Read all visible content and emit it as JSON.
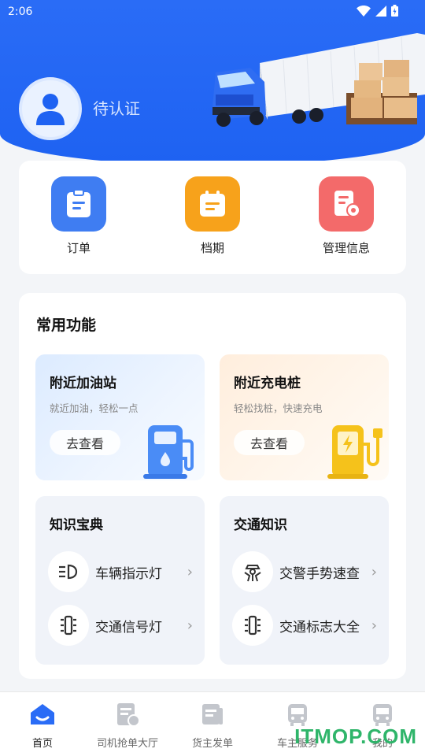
{
  "status_bar": {
    "time": "2:06"
  },
  "profile": {
    "status": "待认证"
  },
  "quick_entries": [
    {
      "label": "订单",
      "color": "#3f7df2"
    },
    {
      "label": "档期",
      "color": "#f7a21b"
    },
    {
      "label": "管理信息",
      "color": "#f36a6a"
    }
  ],
  "functions": {
    "title": "常用功能",
    "gas_station": {
      "title": "附近加油站",
      "subtitle": "就近加油，轻松一点",
      "button": "去查看"
    },
    "charging": {
      "title": "附近充电桩",
      "subtitle": "轻松找桩，快速充电",
      "button": "去查看"
    },
    "knowledge": {
      "title": "知识宝典",
      "items": [
        {
          "label": "车辆指示灯"
        },
        {
          "label": "交通信号灯"
        }
      ]
    },
    "traffic": {
      "title": "交通知识",
      "items": [
        {
          "label": "交警手势速查"
        },
        {
          "label": "交通标志大全"
        }
      ]
    }
  },
  "bottom_nav": [
    {
      "label": "首页",
      "active": true
    },
    {
      "label": "司机抢单大厅"
    },
    {
      "label": "货主发单"
    },
    {
      "label": "车主服务"
    },
    {
      "label": "我的"
    }
  ],
  "watermark": "ITMOP.COM",
  "colors": {
    "brand": "#2a6cf6",
    "accent_blue": "#3f7df2",
    "accent_orange": "#f7a21b",
    "accent_red": "#f36a6a",
    "nav_active": "#2a6cf6"
  }
}
